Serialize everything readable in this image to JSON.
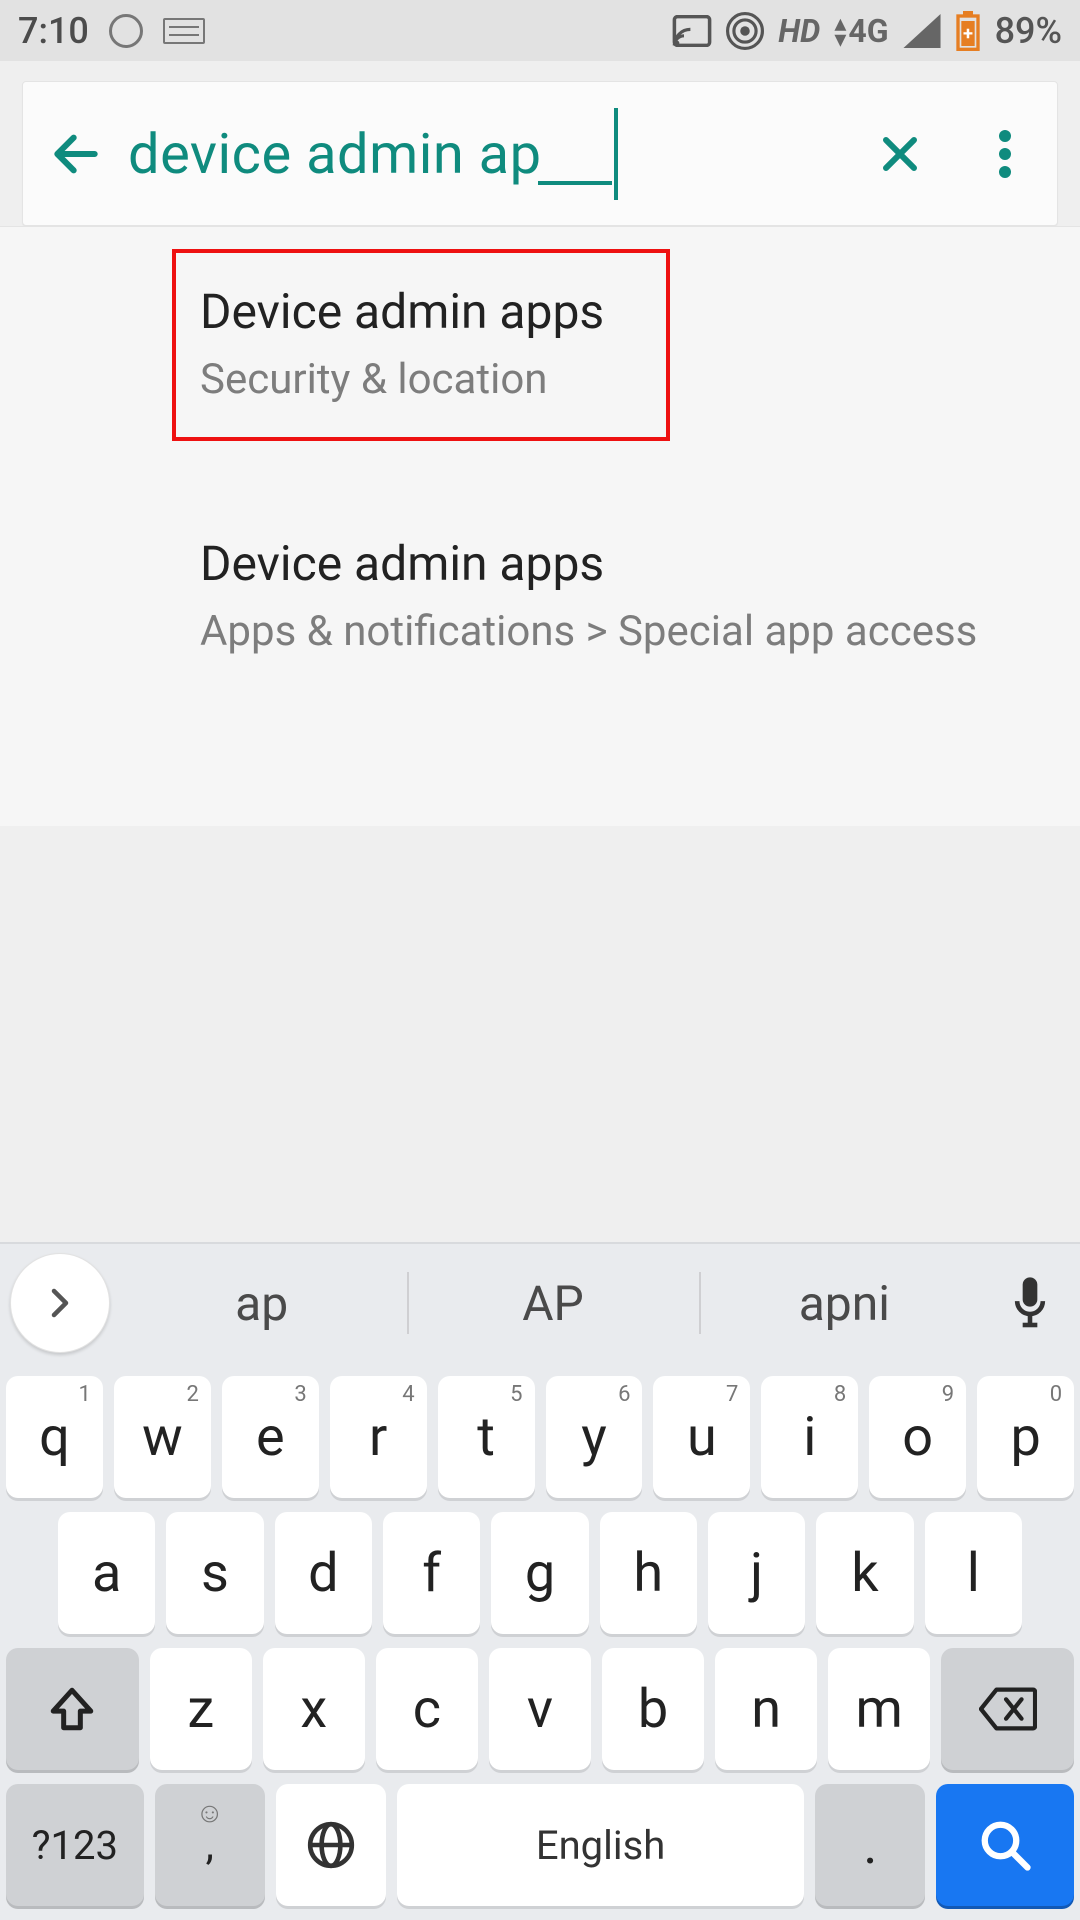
{
  "status": {
    "time": "7:10",
    "network_hd": "HD",
    "network_4g": "4G",
    "battery_pct": "89%"
  },
  "search": {
    "query": "device admin ap",
    "back_icon": "arrow-left",
    "clear_icon": "close",
    "overflow_icon": "more-vert"
  },
  "results": [
    {
      "title": "Device admin apps",
      "subtitle": "Security & location",
      "highlighted": true
    },
    {
      "title": "Device admin apps",
      "subtitle": "Apps & notifications > Special app access",
      "highlighted": false
    }
  ],
  "keyboard": {
    "suggestions": [
      "ap",
      "AP",
      "apni"
    ],
    "row1": [
      {
        "k": "q",
        "n": "1"
      },
      {
        "k": "w",
        "n": "2"
      },
      {
        "k": "e",
        "n": "3"
      },
      {
        "k": "r",
        "n": "4"
      },
      {
        "k": "t",
        "n": "5"
      },
      {
        "k": "y",
        "n": "6"
      },
      {
        "k": "u",
        "n": "7"
      },
      {
        "k": "i",
        "n": "8"
      },
      {
        "k": "o",
        "n": "9"
      },
      {
        "k": "p",
        "n": "0"
      }
    ],
    "row2": [
      "a",
      "s",
      "d",
      "f",
      "g",
      "h",
      "j",
      "k",
      "l"
    ],
    "row3": [
      "z",
      "x",
      "c",
      "v",
      "b",
      "n",
      "m"
    ],
    "symnum": "?123",
    "comma": ",",
    "space_label": "English",
    "period": "."
  }
}
